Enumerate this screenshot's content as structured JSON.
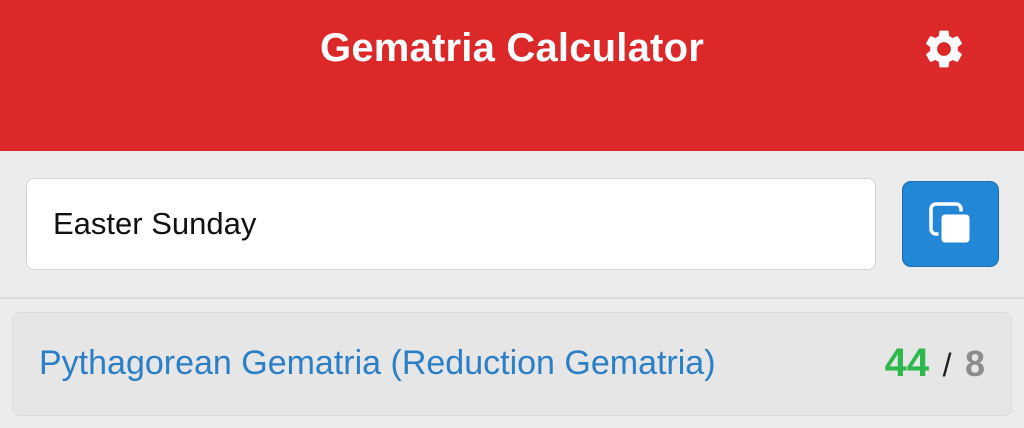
{
  "header": {
    "title": "Gematria Calculator",
    "icon": "gear-icon",
    "background_color": "#dc2829"
  },
  "input": {
    "value": "Easter Sunday",
    "copy_icon": "copy-icon",
    "copy_button_color": "#2287d6"
  },
  "results": [
    {
      "cipher_name": "Pythagorean Gematria (Reduction Gematria)",
      "value": "44",
      "separator": "/",
      "reduced_value": "8",
      "value_color": "#2db84b",
      "name_color": "#2a7fc6"
    }
  ]
}
